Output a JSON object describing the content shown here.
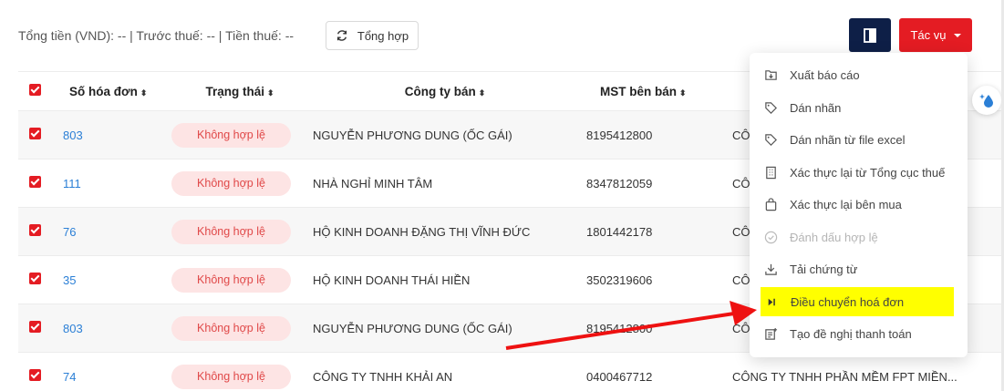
{
  "summary": {
    "text": "Tổng tiền (VND): -- | Trước thuế: -- | Tiền thuế: --",
    "refresh_label": "Tổng hợp"
  },
  "toolbar": {
    "action_label": "Tác vụ"
  },
  "table": {
    "headers": [
      "Số hóa đơn",
      "Trạng thái",
      "Công ty bán",
      "MST bên bán"
    ],
    "rows": [
      {
        "no": "803",
        "status": "Không hợp lệ",
        "company": "NGUYỄN PHƯƠNG DUNG (ỐC GÁI)",
        "mst": "8195412800",
        "buyer": "CÔ"
      },
      {
        "no": "111",
        "status": "Không hợp lệ",
        "company": "NHÀ NGHỈ MINH TÂM",
        "mst": "8347812059",
        "buyer": "CÔ"
      },
      {
        "no": "76",
        "status": "Không hợp lệ",
        "company": "HỘ KINH DOANH ĐẶNG THỊ VĨNH ĐỨC",
        "mst": "1801442178",
        "buyer": "CÔ"
      },
      {
        "no": "35",
        "status": "Không hợp lệ",
        "company": "HỘ KINH DOANH THÁI HIỀN",
        "mst": "3502319606",
        "buyer": "CÔ"
      },
      {
        "no": "803",
        "status": "Không hợp lệ",
        "company": "NGUYỄN PHƯƠNG DUNG (ỐC GÁI)",
        "mst": "8195412800",
        "buyer": "CÔ"
      },
      {
        "no": "74",
        "status": "Không hợp lệ",
        "company": "CÔNG TY TNHH KHẢI AN",
        "mst": "0400467712",
        "buyer": "CÔNG TY TNHH PHẦN MỀM FPT MIỀN..."
      }
    ]
  },
  "menu": {
    "items": [
      {
        "label": "Xuất báo cáo",
        "icon": "export-icon"
      },
      {
        "label": "Dán nhãn",
        "icon": "tag-icon"
      },
      {
        "label": "Dán nhãn từ file excel",
        "icon": "tag-icon"
      },
      {
        "label": "Xác thực lại từ Tổng cục thuế",
        "icon": "building-icon"
      },
      {
        "label": "Xác thực lại bên mua",
        "icon": "bag-icon"
      },
      {
        "label": "Đánh dấu hợp lệ",
        "icon": "check-circle-icon",
        "disabled": true
      },
      {
        "label": "Tải chứng từ",
        "icon": "download-icon"
      },
      {
        "label": "Điều chuyển hoá đơn",
        "icon": "transfer-icon",
        "highlighted": true
      },
      {
        "label": "Tạo đề nghị thanh toán",
        "icon": "request-icon"
      }
    ]
  },
  "colors": {
    "accent_red": "#e41c23",
    "navy": "#0e1f47",
    "highlight": "#ffff00",
    "badge_bg": "#fde4e4",
    "link": "#2b7fd6"
  }
}
